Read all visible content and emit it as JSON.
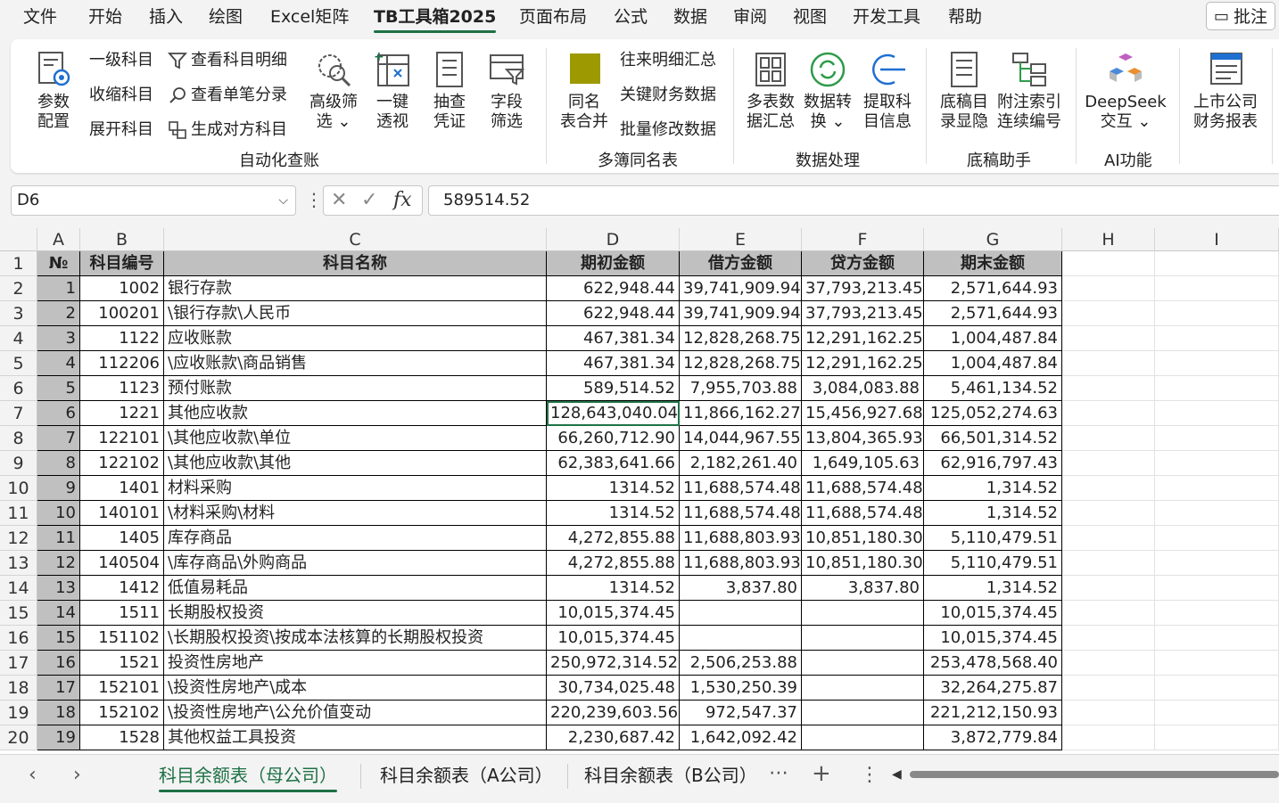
{
  "menu": [
    "文件",
    "开始",
    "插入",
    "绘图",
    "Excel矩阵",
    "TB工具箱2025",
    "页面布局",
    "公式",
    "数据",
    "审阅",
    "视图",
    "开发工具",
    "帮助"
  ],
  "menu_active": "TB工具箱2025",
  "comment_label": "批注",
  "ribbon": {
    "param_config": [
      "参数",
      "配置"
    ],
    "level1": "一级科目",
    "collapse": "收缩科目",
    "expand": "展开科目",
    "view_detail": "查看科目明细",
    "view_single": "查看单笔分录",
    "gen_contra": "生成对方科目",
    "adv_filter": [
      "高级筛",
      "选 ⌄"
    ],
    "pivot": [
      "一键",
      "透视"
    ],
    "sample_voucher": [
      "抽查",
      "凭证"
    ],
    "field_filter": [
      "字段",
      "筛选"
    ],
    "group_auto": "自动化查账",
    "merge_same": [
      "同名",
      "表合并"
    ],
    "ar_detail": "往来明细汇总",
    "key_fin": "关键财务数据",
    "batch_modify": "批量修改数据",
    "group_multi": "多簿同名表",
    "multi_sum": [
      "多表数",
      "据汇总"
    ],
    "data_convert": [
      "数据转",
      "换 ⌄"
    ],
    "extract_acct": [
      "提取科",
      "目信息"
    ],
    "group_data": "数据处理",
    "dir_show": [
      "底稿目",
      "录显隐"
    ],
    "note_index": [
      "附注索引",
      "连续编号"
    ],
    "group_draft": "底稿助手",
    "deepseek": [
      "DeepSeek",
      "交互 ⌄"
    ],
    "group_ai": "AI功能",
    "listed_report": [
      "上市公司",
      "财务报表"
    ]
  },
  "formula_bar": {
    "name_box": "D6",
    "fx": "fx",
    "value": "589514.52"
  },
  "columns": [
    "A",
    "B",
    "C",
    "D",
    "E",
    "F",
    "G",
    "H",
    "I"
  ],
  "headers": [
    "№",
    "科目编号",
    "科目名称",
    "期初金额",
    "借方金额",
    "贷方金额",
    "期末金额"
  ],
  "rows": [
    [
      "1",
      "1002",
      "银行存款",
      "622,948.44",
      "39,741,909.94",
      "37,793,213.45",
      "2,571,644.93"
    ],
    [
      "2",
      "100201",
      "\\银行存款\\人民币",
      "622,948.44",
      "39,741,909.94",
      "37,793,213.45",
      "2,571,644.93"
    ],
    [
      "3",
      "1122",
      "应收账款",
      "467,381.34",
      "12,828,268.75",
      "12,291,162.25",
      "1,004,487.84"
    ],
    [
      "4",
      "112206",
      "\\应收账款\\商品销售",
      "467,381.34",
      "12,828,268.75",
      "12,291,162.25",
      "1,004,487.84"
    ],
    [
      "5",
      "1123",
      "预付账款",
      "589,514.52",
      "7,955,703.88",
      "3,084,083.88",
      "5,461,134.52"
    ],
    [
      "6",
      "1221",
      "其他应收款",
      "128,643,040.04",
      "11,866,162.27",
      "15,456,927.68",
      "125,052,274.63"
    ],
    [
      "7",
      "122101",
      "\\其他应收款\\单位",
      "66,260,712.90",
      "14,044,967.55",
      "13,804,365.93",
      "66,501,314.52"
    ],
    [
      "8",
      "122102",
      "\\其他应收款\\其他",
      "62,383,641.66",
      "2,182,261.40",
      "1,649,105.63",
      "62,916,797.43"
    ],
    [
      "9",
      "1401",
      "材料采购",
      "1314.52",
      "11,688,574.48",
      "11,688,574.48",
      "1,314.52"
    ],
    [
      "10",
      "140101",
      "\\材料采购\\材料",
      "1314.52",
      "11,688,574.48",
      "11,688,574.48",
      "1,314.52"
    ],
    [
      "11",
      "1405",
      "库存商品",
      "4,272,855.88",
      "11,688,803.93",
      "10,851,180.30",
      "5,110,479.51"
    ],
    [
      "12",
      "140504",
      "\\库存商品\\外购商品",
      "4,272,855.88",
      "11,688,803.93",
      "10,851,180.30",
      "5,110,479.51"
    ],
    [
      "13",
      "1412",
      "低值易耗品",
      "1314.52",
      "3,837.80",
      "3,837.80",
      "1,314.52"
    ],
    [
      "14",
      "1511",
      "长期股权投资",
      "10,015,374.45",
      "",
      "",
      "10,015,374.45"
    ],
    [
      "15",
      "151102",
      "\\长期股权投资\\按成本法核算的长期股权投资",
      "10,015,374.45",
      "",
      "",
      "10,015,374.45"
    ],
    [
      "16",
      "1521",
      "投资性房地产",
      "250,972,314.52",
      "2,506,253.88",
      "",
      "253,478,568.40"
    ],
    [
      "17",
      "152101",
      "\\投资性房地产\\成本",
      "30,734,025.48",
      "1,530,250.39",
      "",
      "32,264,275.87"
    ],
    [
      "18",
      "152102",
      "\\投资性房地产\\公允价值变动",
      "220,239,603.56",
      "972,547.37",
      "",
      "221,212,150.93"
    ],
    [
      "19",
      "1528",
      "其他权益工具投资",
      "2,230,687.42",
      "1,642,092.42",
      "",
      "3,872,779.84"
    ]
  ],
  "sheet_tabs": [
    "科目余额表（母公司）",
    "科目余额表（A公司）",
    "科目余额表（B公司）"
  ],
  "active_sheet": 0,
  "accent_color": "#1e7145",
  "header_fill": "#c0c0c0"
}
